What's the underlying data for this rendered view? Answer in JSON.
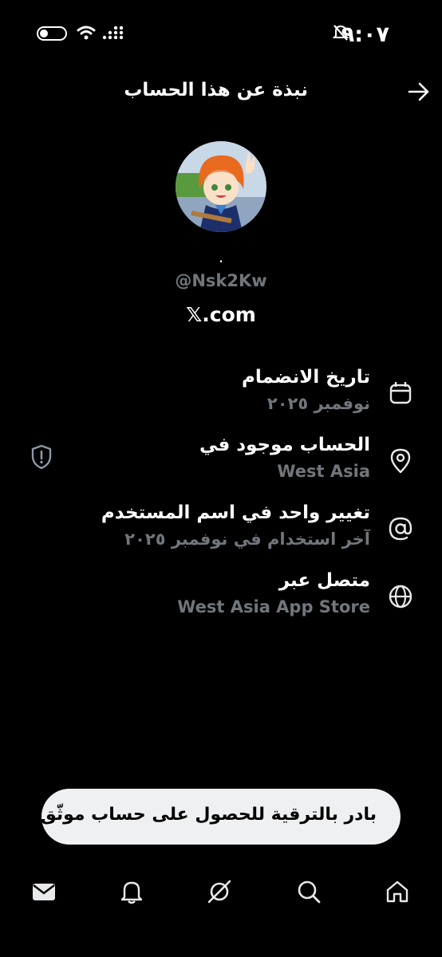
{
  "status_bar": {
    "time": "٩:٠٧"
  },
  "header": {
    "title": "نبذة عن هذا الحساب"
  },
  "profile": {
    "display_name": ".",
    "handle": "@Nsk2Kw",
    "site": "𝕏.com"
  },
  "details": [
    {
      "icon": "calendar-icon",
      "title": "تاريخ الانضمام",
      "value": "نوفمبر ٢٠٢٥"
    },
    {
      "icon": "location-pin-icon",
      "title": "الحساب موجود في",
      "value": "West Asia"
    },
    {
      "icon": "at-sign-icon",
      "title": "تغيير واحد في اسم المستخدم",
      "value": "آخر استخدام في نوفمبر ٢٠٢٥"
    },
    {
      "icon": "globe-icon",
      "title": "متصل عبر",
      "value": "West Asia App Store"
    }
  ],
  "upgrade": {
    "label": "بادر بالترقية للحصول على حساب موثّق"
  },
  "tabbar": [
    "mail-icon",
    "bell-icon",
    "grok-icon",
    "search-icon",
    "home-icon"
  ],
  "colors": {
    "background": "#000000",
    "text": "#ffffff",
    "secondary": "#71767b",
    "pill": "#eef0f1"
  }
}
